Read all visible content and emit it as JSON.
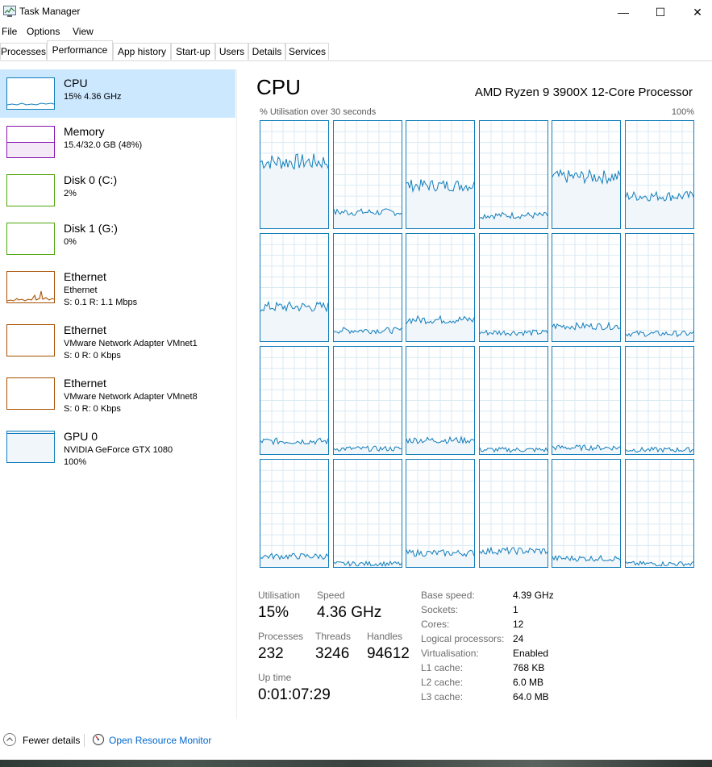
{
  "window": {
    "title": "Task Manager",
    "minimize": "—",
    "maximize": "☐",
    "close": "✕"
  },
  "menu": [
    "File",
    "Options",
    "View"
  ],
  "tabs": [
    "Processes",
    "Performance",
    "App history",
    "Start-up",
    "Users",
    "Details",
    "Services"
  ],
  "active_tab": "Performance",
  "sidebar": [
    {
      "name": "CPU",
      "lines": [
        "15% 4.36 GHz"
      ],
      "color": "#117dbb",
      "selected": true
    },
    {
      "name": "Memory",
      "lines": [
        "15.4/32.0 GB (48%)"
      ],
      "color": "#8b12ae",
      "selected": false
    },
    {
      "name": "Disk 0 (C:)",
      "lines": [
        "2%"
      ],
      "color": "#4da60c",
      "selected": false
    },
    {
      "name": "Disk 1 (G:)",
      "lines": [
        "0%"
      ],
      "color": "#4da60c",
      "selected": false
    },
    {
      "name": "Ethernet",
      "lines": [
        "Ethernet",
        "S: 0.1 R: 1.1 Mbps"
      ],
      "color": "#a74f01",
      "selected": false
    },
    {
      "name": "Ethernet",
      "lines": [
        "VMware Network Adapter VMnet1",
        "S: 0 R: 0 Kbps"
      ],
      "color": "#a74f01",
      "selected": false
    },
    {
      "name": "Ethernet",
      "lines": [
        "VMware Network Adapter VMnet8",
        "S: 0 R: 0 Kbps"
      ],
      "color": "#a74f01",
      "selected": false
    },
    {
      "name": "GPU 0",
      "lines": [
        "NVIDIA GeForce GTX 1080",
        "100%"
      ],
      "color": "#117dbb",
      "selected": false
    }
  ],
  "main": {
    "title": "CPU",
    "processor": "AMD Ryzen 9 3900X 12-Core Processor",
    "graph_label": "% Utilisation over 30 seconds",
    "graph_max": "100%",
    "core_levels": [
      0.62,
      0.15,
      0.4,
      0.12,
      0.48,
      0.3,
      0.32,
      0.1,
      0.2,
      0.08,
      0.14,
      0.07,
      0.12,
      0.05,
      0.13,
      0.04,
      0.06,
      0.04,
      0.1,
      0.03,
      0.13,
      0.15,
      0.08,
      0.03
    ],
    "accent": "#117dbb",
    "fill": "#f1f6fa",
    "grid": "#d9eaf4"
  },
  "stats": {
    "utilisation_label": "Utilisation",
    "utilisation": "15%",
    "speed_label": "Speed",
    "speed": "4.36 GHz",
    "processes_label": "Processes",
    "processes": "232",
    "threads_label": "Threads",
    "threads": "3246",
    "handles_label": "Handles",
    "handles": "94612",
    "uptime_label": "Up time",
    "uptime": "0:01:07:29"
  },
  "specs": [
    {
      "label": "Base speed:",
      "value": "4.39 GHz"
    },
    {
      "label": "Sockets:",
      "value": "1"
    },
    {
      "label": "Cores:",
      "value": "12"
    },
    {
      "label": "Logical processors:",
      "value": "24"
    },
    {
      "label": "Virtualisation:",
      "value": "Enabled"
    },
    {
      "label": "L1 cache:",
      "value": "768 KB"
    },
    {
      "label": "L2 cache:",
      "value": "6.0 MB"
    },
    {
      "label": "L3 cache:",
      "value": "64.0 MB"
    }
  ],
  "footer": {
    "fewer_details": "Fewer details",
    "resource_monitor": "Open Resource Monitor"
  }
}
